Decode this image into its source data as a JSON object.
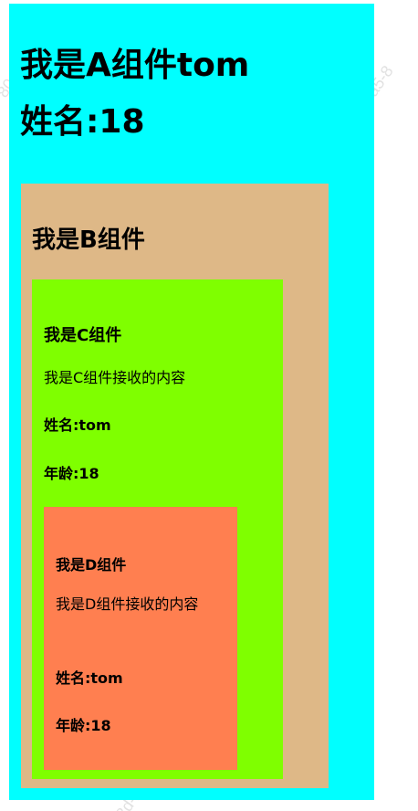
{
  "component_a": {
    "title": "我是A组件tom",
    "name_line": "姓名:18"
  },
  "component_b": {
    "title": "我是B组件"
  },
  "component_c": {
    "title": "我是C组件",
    "received": "我是C组件接收的内容",
    "name": "姓名:tom",
    "age": "年龄:18"
  },
  "component_d": {
    "title": "我是D组件",
    "received": "我是D组件接收的内容",
    "name": "姓名:tom",
    "age": "年龄:18"
  },
  "watermarks": [
    "80-a5-89-8",
    "80-a5-8",
    "zhou_210522",
    "80-a5-89-82-91-8d-zhou",
    "8d-zhou_210522"
  ],
  "colors": {
    "component_a": "#00ffff",
    "component_b": "#deb887",
    "component_c": "#7fff00",
    "component_d": "#ff7f50"
  }
}
